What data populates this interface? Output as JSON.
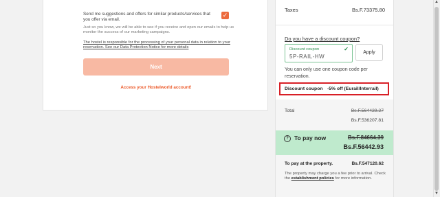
{
  "form": {
    "consent_text": "Send me suggestions and offers for similar products/services that you offer via email.",
    "info_text": "Just so you know, we will be able to see if you receive and open our emails to help us monitor the success of our marketing campaigns.",
    "policy_link": "The hostel is responsible for the processing of your personal data in relation to your reservation. See our Data Protection Notice for more details",
    "next_label": "Next",
    "account_link": "Access your Hostelworld account!",
    "checkbox_checked": true
  },
  "summary": {
    "taxes_label": "Taxes",
    "taxes_value": "Bs.F.73375.80",
    "discount_question": "Do you have a discount coupon?",
    "coupon_label": "Discount coupon",
    "coupon_value": "5P-RAIL-HW",
    "apply_label": "Apply",
    "coupon_note": "You can only use one coupon code per reservation.",
    "discount_row_label": "Discount coupon",
    "discount_row_value": "-5% off (Eurail/Interrail)",
    "total_label": "Total",
    "total_old": "Bs.F.564429.27",
    "total_new": "Bs.F.536207.81",
    "pay_now_label": "To pay now",
    "pay_now_old": "Bs.F.84664.39",
    "pay_now_new": "Bs.F.56442.93",
    "pay_property_label": "To pay at the property.",
    "pay_property_amount": "Bs.F.547120.62",
    "pay_property_note_prefix": "The property may charge you a fee prior to arrival. Check the ",
    "pay_property_note_link": "establishment policies",
    "pay_property_note_suffix": " for more information."
  },
  "colors": {
    "accent": "#ec6a3d",
    "next_button_disabled": "#f8b9a3",
    "coupon_border": "#7bc393",
    "pay_now_bg": "#bfeacd",
    "highlight_red": "#d81f26"
  },
  "icons": {
    "checkbox": "check-icon",
    "coupon_valid": "check-icon",
    "pay_now_help": "question-circle-icon"
  }
}
